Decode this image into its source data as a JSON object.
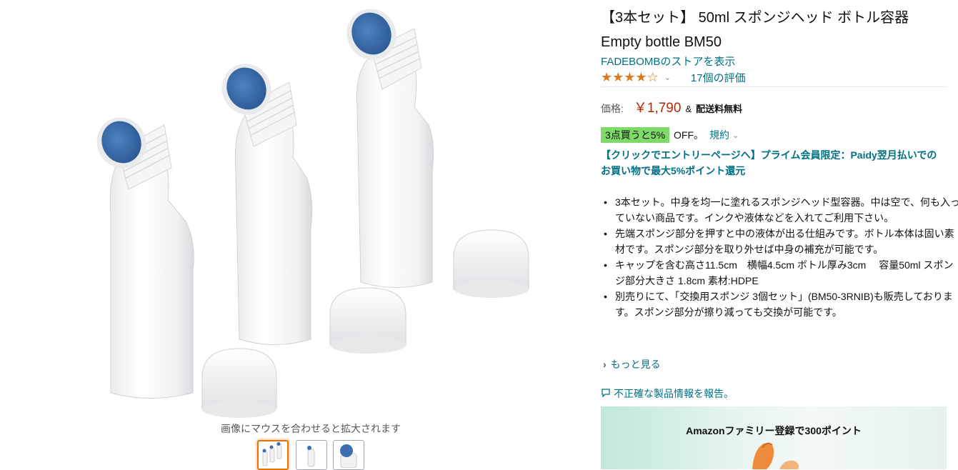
{
  "gallery": {
    "zoom_hint": "画像にマウスを合わせると拡大されます",
    "thumbnails": [
      "three-bottles",
      "single-bottle",
      "sponge-closeup"
    ],
    "selected_thumbnail": 0
  },
  "product": {
    "title": "【3本セット】 50ml スポンジヘッド ボトル容器 Empty bottle BM50",
    "store_link": "FADEBOMBのストアを表示",
    "rating": {
      "stars": "★★★★☆",
      "value": 4,
      "chevron": "⌄",
      "count_text": "17個の評価"
    },
    "price": {
      "label": "価格:",
      "value": "￥1,790",
      "amp": "&",
      "shipping": "配送料無料"
    },
    "promo": {
      "badge": "3点買うと5%",
      "off": "OFF。",
      "terms": "規約",
      "chevron": "⌄"
    },
    "campaign": "【クリックでエントリーページへ】プライム会員限定：Paidy翌月払いでのお買い物で最大5%ポイント還元",
    "bullets": [
      "3本セット。中身を均一に塗れるスポンジヘッド型容器。中は空で、何も入っていない商品です。インクや液体などを入れてご利用下さい。",
      "先端スポンジ部分を押すと中の液体が出る仕組みです。ボトル本体は固い素材です。スポンジ部分を取り外せば中身の補充が可能です。",
      "キャップを含む高さ11.5cm　横幅4.5cm ボトル厚み3cm　 容量50ml スポンジ部分大きさ 1.8cm 素材:HDPE",
      "別売りにて、「交換用スポンジ 3個セット」(BM50-3RNIB)も販売しております。スポンジ部分が擦り減っても交換が可能です。"
    ],
    "more_link": "もっと見る",
    "report_link": "不正確な製品情報を報告。",
    "family_banner": "Amazonファミリー登録で300ポイント"
  },
  "colors": {
    "link": "#007185",
    "price": "#b12704",
    "star": "#de7921",
    "promo_badge": "#7fda69",
    "sponge": "#3b6fb0"
  }
}
